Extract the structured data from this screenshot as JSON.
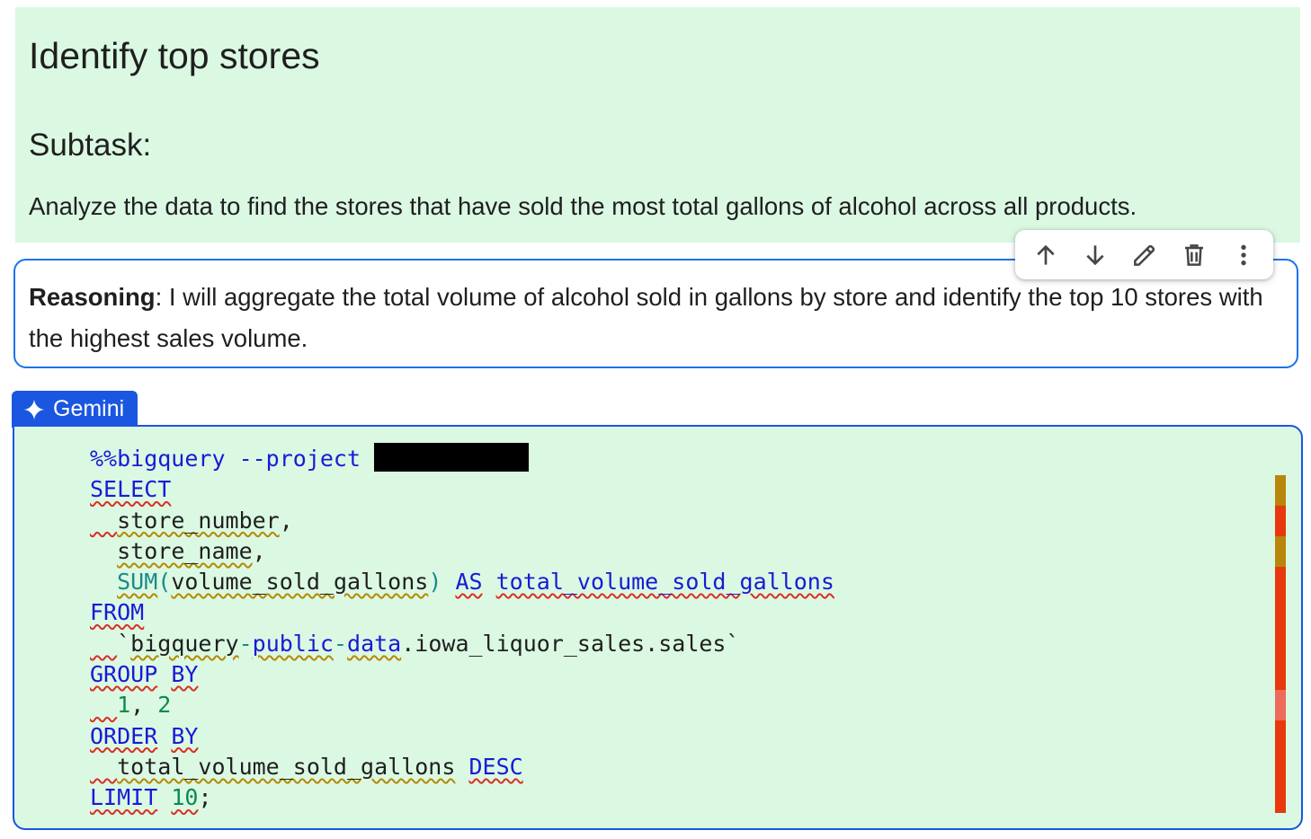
{
  "markdown": {
    "title": "Identify top stores",
    "subtask": "Subtask:",
    "body": "Analyze the data to find the stores that have sold the most total gallons of alcohol across all products."
  },
  "reasoning": {
    "label": "Reasoning",
    "text": ": I will aggregate the total volume of alcohol sold in gallons by store and identify the top 10 stores with the highest sales volume."
  },
  "toolbar": {
    "icons": [
      "arrow-up-icon",
      "arrow-down-icon",
      "pencil-icon",
      "trash-icon",
      "more-vert-icon"
    ]
  },
  "gemini": {
    "label": "Gemini"
  },
  "code": {
    "magic": "%%bigquery --project",
    "lines": {
      "select": "SELECT",
      "col1": "store_number",
      "col2": "store_name",
      "sum_fn": "SUM",
      "sum_arg": "volume_sold_gallons",
      "as_kw": "AS",
      "alias": "total_volume_sold_gallons",
      "from": "FROM",
      "table_p1": "bigquery",
      "table_p2": "public",
      "table_p3": "data",
      "table_p4": ".iowa_liquor_sales.sales",
      "group": "GROUP",
      "by1": "BY",
      "group_n1": "1",
      "group_n2": "2",
      "order": "ORDER",
      "by2": "BY",
      "order_col": "total_volume_sold_gallons",
      "desc": "DESC",
      "limit": "LIMIT",
      "limit_n": "10"
    }
  },
  "colors": {
    "cell_bg": "#dbf8e2",
    "focus_border": "#1a73e8",
    "gemini_blue": "#1a56e0",
    "keyword": "#1a1ad6",
    "error_mark": "#e8380d",
    "warning_mark": "#b8860b"
  }
}
